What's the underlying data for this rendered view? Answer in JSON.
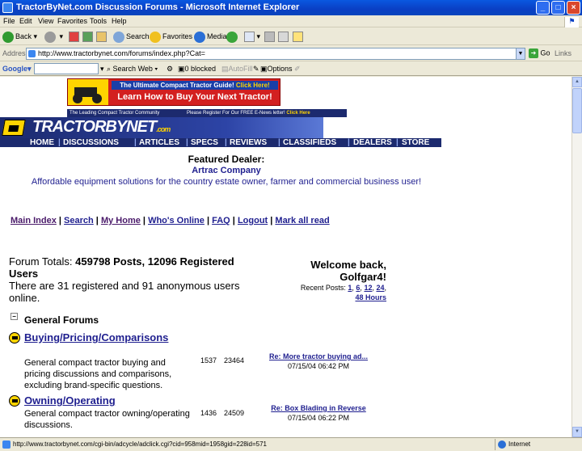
{
  "window": {
    "title": "TractorByNet.com Discussion Forums - Microsoft Internet Explorer",
    "controls": [
      "_",
      "□",
      "×"
    ]
  },
  "menu": [
    "File",
    "Edit",
    "View",
    "Favorites",
    "Tools",
    "Help"
  ],
  "toolbar": {
    "back": "Back",
    "search": "Search",
    "favorites": "Favorites",
    "media": "Media"
  },
  "address": {
    "label": "Address",
    "url": "http://www.tractorbynet.com/forums/index.php?Cat=",
    "go": "Go",
    "links": "Links"
  },
  "googlebar": {
    "brand": "Google",
    "search_web": "Search Web",
    "blocked": "0 blocked",
    "autofill": "AutoFill",
    "options": "Options"
  },
  "banner": {
    "top": "The Ultimate Compact Tractor Guide!",
    "top_link": "Click Here!",
    "main": "Learn How to Buy Your Next Tractor!",
    "tagline_left": "The Leading Compact Tractor Community",
    "tagline_right": "Please Register For Our FREE E-News letter!",
    "tagline_link": "Click Here"
  },
  "logo": {
    "brand": "TRACTORBYNET",
    "suffix": ".com"
  },
  "nav": [
    "HOME",
    "DISCUSSIONS",
    "ARTICLES",
    "SPECS",
    "REVIEWS",
    "CLASSIFIEDS",
    "DEALERS",
    "STORE"
  ],
  "featured": {
    "heading": "Featured Dealer:",
    "name": "Artrac Company",
    "desc": "Affordable equipment solutions for the country estate owner, farmer and commercial business user!"
  },
  "links": {
    "main_index": "Main Index",
    "search": "Search",
    "my_home": "My Home",
    "whos_online": "Who's Online",
    "faq": "FAQ",
    "logout": "Logout",
    "mark_all_read": "Mark all read"
  },
  "totals": {
    "prefix": "Forum Totals:",
    "posts": "459798 Posts, 12096 Registered Users",
    "online": "There are 31 registered and 91 anonymous users online."
  },
  "welcome": {
    "text": "Welcome back, Golfgar4!",
    "recent_label": "Recent Posts:",
    "recent_links": [
      "1",
      "6",
      "12",
      "24",
      "48 Hours"
    ]
  },
  "section": {
    "title": "General Forums",
    "toggle": "−"
  },
  "forums": [
    {
      "title": "Buying/Pricing/Comparisons",
      "desc": "General compact tractor buying and pricing discussions and comparisons, excluding brand-specific questions.",
      "threads": "1537",
      "posts": "23464",
      "last_title": "Re: More tractor buying ad...",
      "last_date": "07/15/04 06:42 PM"
    },
    {
      "title": "Owning/Operating",
      "desc": "General compact tractor owning/operating discussions.",
      "threads": "1436",
      "posts": "24509",
      "last_title": "Re: Box Blading in Reverse",
      "last_date": "07/15/04 06:22 PM"
    }
  ],
  "status": {
    "url": "http://www.tractorbynet.com/cgi-bin/adcycle/adclick.cgi?cid=958mid=1958gid=228id=571",
    "zone": "Internet"
  }
}
